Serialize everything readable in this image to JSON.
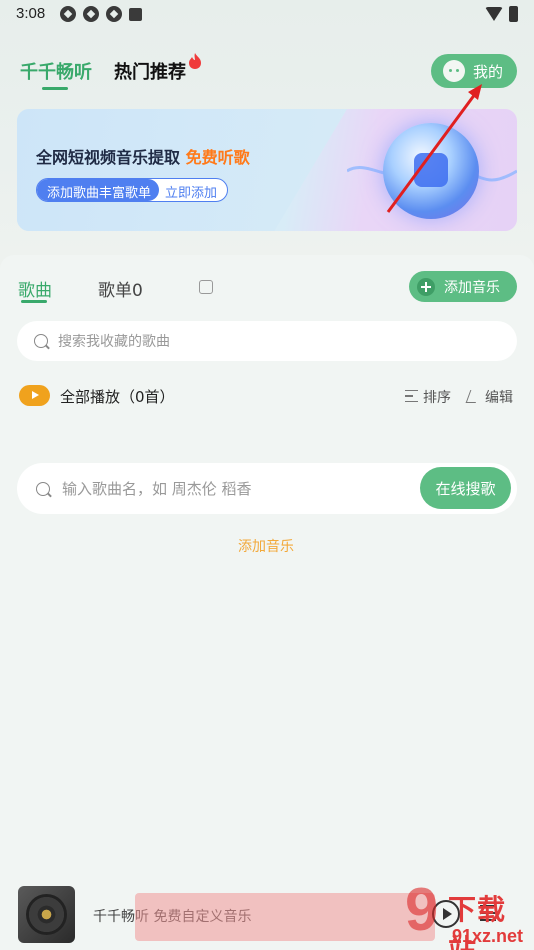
{
  "status_bar": {
    "time": "3:08",
    "notif_icons": [
      "app-icon",
      "app-icon",
      "app-icon",
      "a-icon"
    ],
    "right_icons": [
      "wifi-icon",
      "battery-icon"
    ]
  },
  "header": {
    "tab_active": "千千畅听",
    "tab_recommend": "热门推荐",
    "mine_button": "我的"
  },
  "banner": {
    "title_main": "全网短视频音乐提取 ",
    "title_highlight": "免费听歌",
    "pill_left": "添加歌曲丰富歌单",
    "pill_right": "立即添加"
  },
  "tabs": {
    "songs": "歌曲",
    "playlists": "歌单0",
    "add_music": "添加音乐"
  },
  "search_favorites": {
    "placeholder": "搜索我收藏的歌曲"
  },
  "list_controls": {
    "play_all": "全部播放（0首）",
    "sort": "排序",
    "edit": "编辑"
  },
  "online_search": {
    "placeholder": "输入歌曲名，如 周杰伦 稻香",
    "button": "在线搜歌"
  },
  "add_music_link": "添加音乐",
  "player": {
    "title": "千千畅听 免费自定义音乐"
  },
  "watermark": {
    "logo": "9",
    "text_top": "下载站",
    "text_bottom": "91xz.net"
  },
  "colors": {
    "accent": "#39a96b",
    "button_green": "#5dbd84",
    "orange": "#ff7a1a",
    "blue": "#4f7ff0",
    "play_orange": "#f0a21d"
  }
}
